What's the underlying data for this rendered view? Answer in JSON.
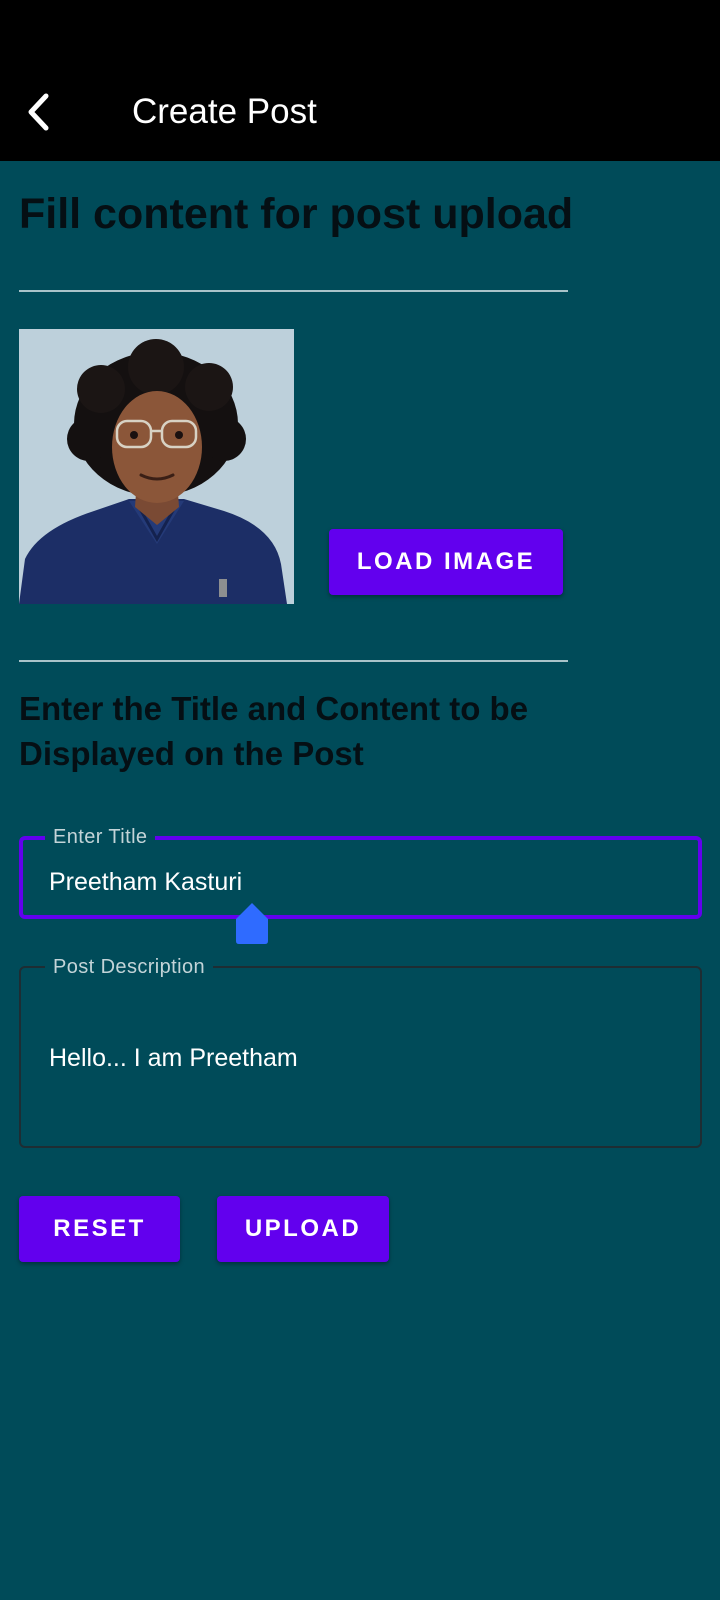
{
  "app_bar": {
    "title": "Create Post",
    "back_icon": "arrow-back-icon"
  },
  "section_heading": "Fill content for post upload",
  "image_section": {
    "load_button_label": "LOAD IMAGE",
    "preview_alt": "Portrait of a man with curly hair and glasses in a navy shirt"
  },
  "instruction": "Enter the Title and Content to be Displayed on the Post",
  "title_field": {
    "label": "Enter Title",
    "value": "Preetham Kasturi"
  },
  "description_field": {
    "label": "Post Description",
    "value": "Hello... I am Preetham"
  },
  "actions": {
    "reset_label": "RESET",
    "upload_label": "UPLOAD"
  },
  "colors": {
    "background": "#004b59",
    "app_bar": "#000000",
    "accent": "#6200ee",
    "cursor_handle": "#2f6bff"
  }
}
